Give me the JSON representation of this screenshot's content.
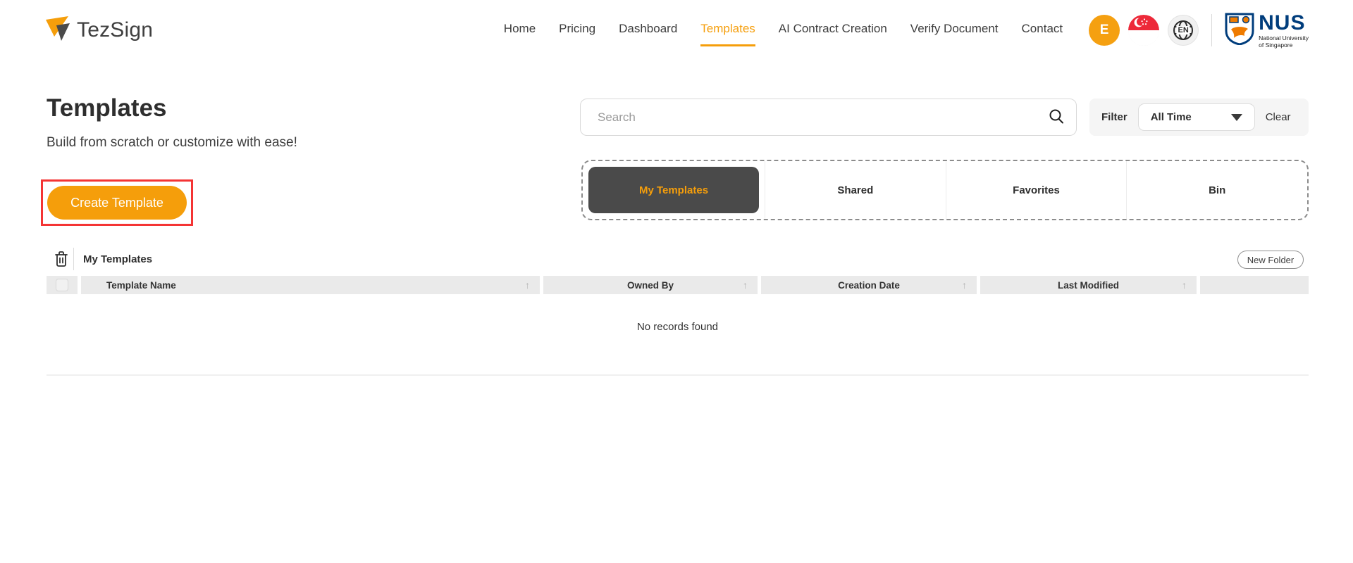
{
  "header": {
    "logo_text": "TezSign",
    "nav": [
      {
        "label": "Home",
        "active": false
      },
      {
        "label": "Pricing",
        "active": false
      },
      {
        "label": "Dashboard",
        "active": false
      },
      {
        "label": "Templates",
        "active": true
      },
      {
        "label": "AI Contract Creation",
        "active": false
      },
      {
        "label": "Verify Document",
        "active": false
      },
      {
        "label": "Contact",
        "active": false
      }
    ],
    "avatar_initial": "E",
    "language": "EN",
    "nus_logo": {
      "acronym": "NUS",
      "name_line1": "National University",
      "name_line2": "of Singapore"
    }
  },
  "page": {
    "title": "Templates",
    "subtitle": "Build from scratch or customize with ease!",
    "create_button_label": "Create Template"
  },
  "search": {
    "placeholder": "Search"
  },
  "filter": {
    "label": "Filter",
    "selected_option": "All Time",
    "clear_label": "Clear"
  },
  "tabs": [
    {
      "label": "My Templates",
      "active": true
    },
    {
      "label": "Shared",
      "active": false
    },
    {
      "label": "Favorites",
      "active": false
    },
    {
      "label": "Bin",
      "active": false
    }
  ],
  "templates_list": {
    "section_title": "My Templates",
    "new_folder_label": "New Folder",
    "columns": [
      "Template Name",
      "Owned By",
      "Creation Date",
      "Last Modified"
    ],
    "sort_icon": "↑",
    "empty_message": "No records found"
  },
  "colors": {
    "accent_orange": "#F59E0B",
    "highlight_red": "#F43434",
    "active_tab_bg": "#4A4A4A",
    "nus_blue": "#003D7C",
    "nus_orange": "#EF7B00",
    "flag_red": "#ED2939"
  }
}
